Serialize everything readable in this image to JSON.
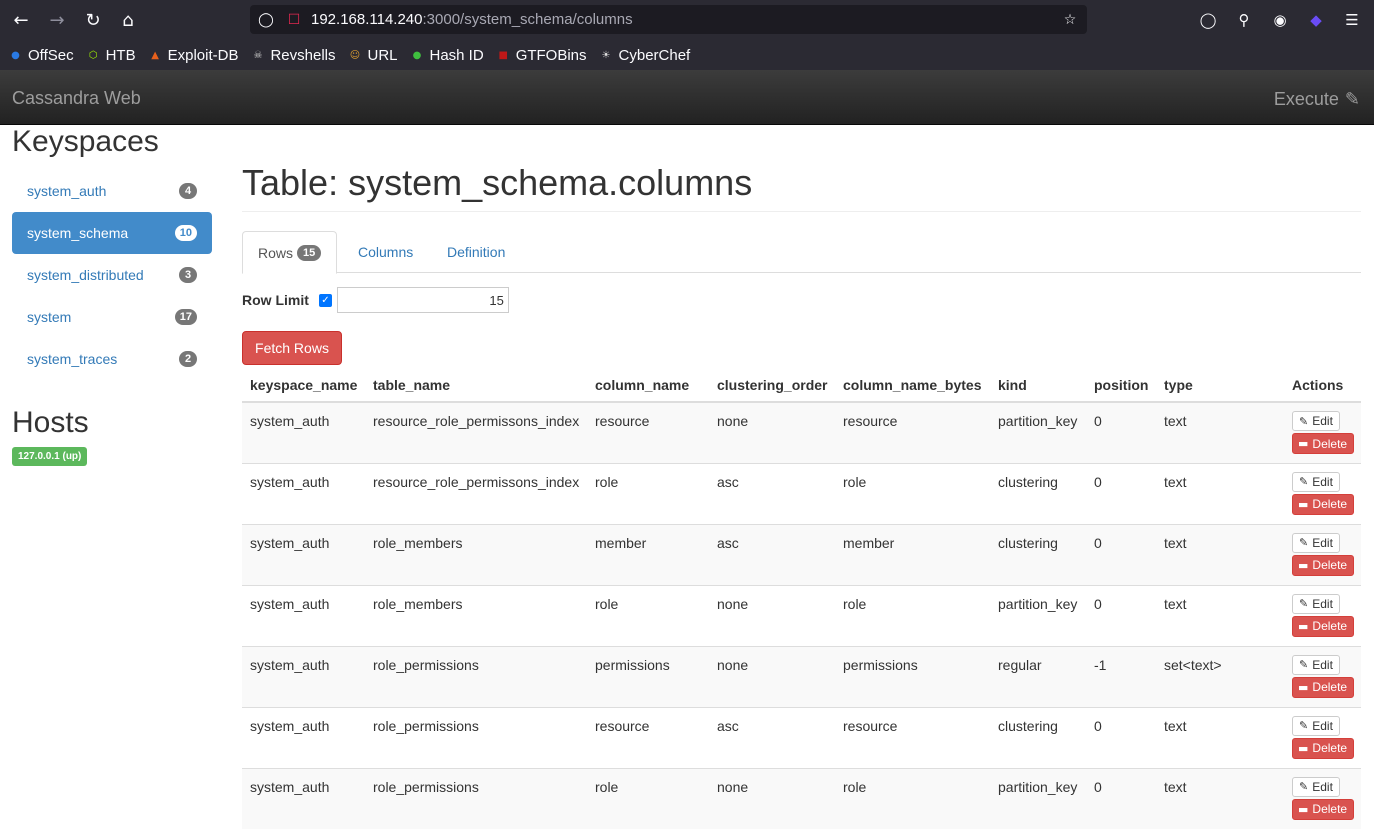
{
  "browser": {
    "url_host": "192.168.114.240",
    "url_path": ":3000/system_schema/columns",
    "bookmarks": [
      {
        "label": "OffSec",
        "icon": "offsec-icon",
        "color": "#2a7ae4"
      },
      {
        "label": "HTB",
        "icon": "htb-icon",
        "color": "#9fef00"
      },
      {
        "label": "Exploit-DB",
        "icon": "exploit-db-icon",
        "color": "#e8601c"
      },
      {
        "label": "Revshells",
        "icon": "skull-icon",
        "color": "#cccccc"
      },
      {
        "label": "URL",
        "icon": "url-icon",
        "color": "#e0a030"
      },
      {
        "label": "Hash ID",
        "icon": "hash-id-icon",
        "color": "#3fbf3f"
      },
      {
        "label": "GTFOBins",
        "icon": "gtfobins-icon",
        "color": "#c01818"
      },
      {
        "label": "CyberChef",
        "icon": "chef-icon",
        "color": "#dddddd"
      }
    ]
  },
  "app": {
    "brand": "Cassandra Web",
    "execute_label": "Execute"
  },
  "sidebar": {
    "keyspaces_heading": "Keyspaces",
    "keyspaces": [
      {
        "name": "system_auth",
        "count": "4",
        "active": false
      },
      {
        "name": "system_schema",
        "count": "10",
        "active": true
      },
      {
        "name": "system_distributed",
        "count": "3",
        "active": false
      },
      {
        "name": "system",
        "count": "17",
        "active": false
      },
      {
        "name": "system_traces",
        "count": "2",
        "active": false
      }
    ],
    "hosts_heading": "Hosts",
    "host": "127.0.0.1 (up)"
  },
  "main": {
    "title": "Table: system_schema.columns",
    "tabs": [
      {
        "label": "Rows",
        "badge": "15"
      },
      {
        "label": "Columns"
      },
      {
        "label": "Definition"
      }
    ],
    "row_limit_label": "Row Limit",
    "row_limit_enabled": true,
    "row_limit_value": "15",
    "fetch_button": "Fetch Rows",
    "edit_label": "Edit",
    "delete_label": "Delete",
    "columns": [
      "keyspace_name",
      "table_name",
      "column_name",
      "clustering_order",
      "column_name_bytes",
      "kind",
      "position",
      "type",
      "Actions"
    ],
    "rows": [
      [
        "system_auth",
        "resource_role_permissons_index",
        "resource",
        "none",
        "resource",
        "partition_key",
        "0",
        "text"
      ],
      [
        "system_auth",
        "resource_role_permissons_index",
        "role",
        "asc",
        "role",
        "clustering",
        "0",
        "text"
      ],
      [
        "system_auth",
        "role_members",
        "member",
        "asc",
        "member",
        "clustering",
        "0",
        "text"
      ],
      [
        "system_auth",
        "role_members",
        "role",
        "none",
        "role",
        "partition_key",
        "0",
        "text"
      ],
      [
        "system_auth",
        "role_permissions",
        "permissions",
        "none",
        "permissions",
        "regular",
        "-1",
        "set<text>"
      ],
      [
        "system_auth",
        "role_permissions",
        "resource",
        "asc",
        "resource",
        "clustering",
        "0",
        "text"
      ],
      [
        "system_auth",
        "role_permissions",
        "role",
        "none",
        "role",
        "partition_key",
        "0",
        "text"
      ]
    ]
  }
}
